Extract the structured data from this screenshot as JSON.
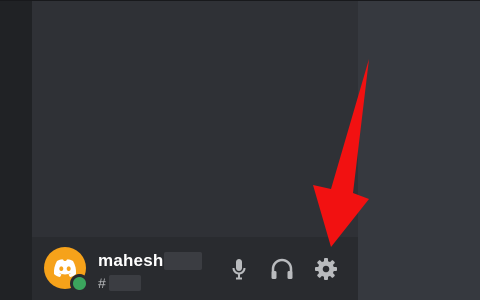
{
  "user_panel": {
    "username": "mahesh",
    "tag_prefix": "#",
    "status": "online"
  },
  "colors": {
    "server_rail": "#202225",
    "channel_sidebar": "#2f3136",
    "main_area": "#36393f",
    "user_panel": "#292b2f",
    "avatar": "#f6a21a",
    "status_online": "#3ba55d",
    "icon": "#b9bbbe",
    "annotation_arrow": "#f21111"
  },
  "icons": {
    "avatar": "discord-logo-icon",
    "mic": "microphone-icon",
    "headphones": "headphones-icon",
    "settings": "gear-icon",
    "annotation": "red-arrow-icon"
  }
}
